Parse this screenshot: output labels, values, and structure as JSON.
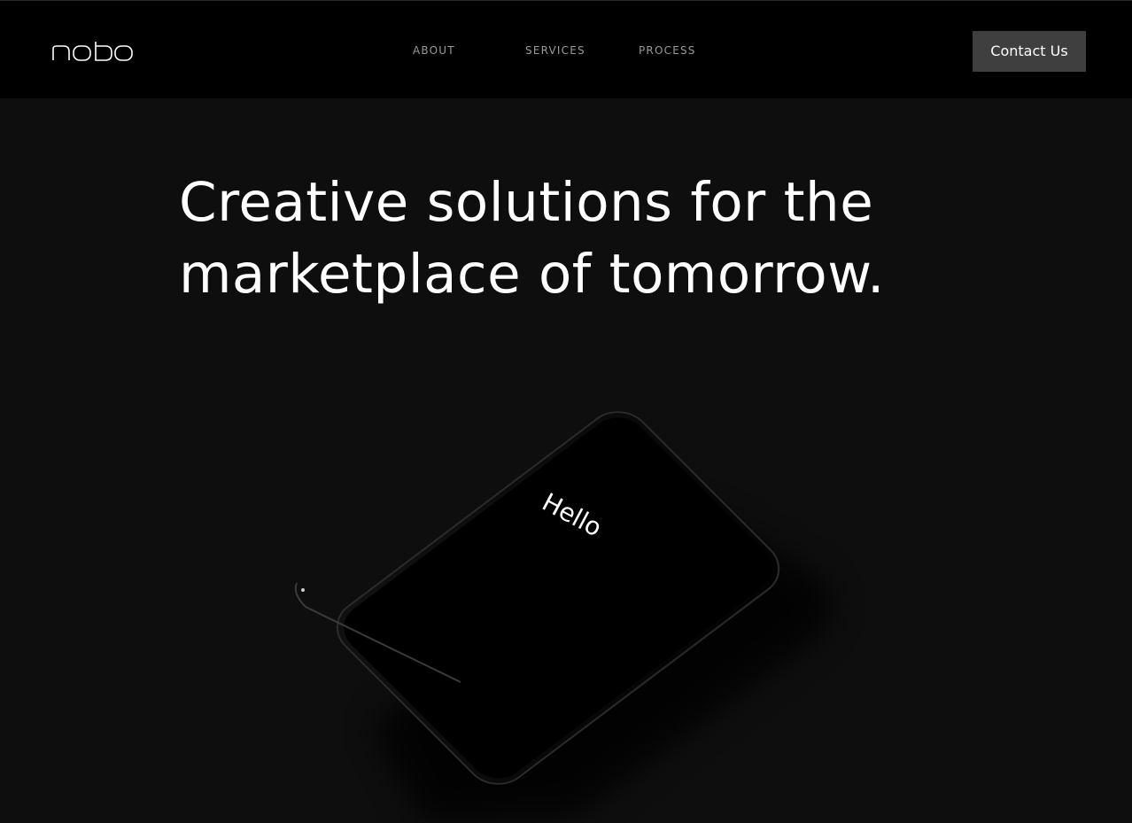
{
  "brand": {
    "logo_text": "nobo"
  },
  "nav": {
    "items": [
      {
        "label": "ABOUT"
      },
      {
        "label": "SERVICES"
      },
      {
        "label": "PROCESS"
      }
    ],
    "contact_label": "Contact Us"
  },
  "hero": {
    "title_line1": "Creative solutions for the",
    "title_line2": "marketplace of tomorrow.",
    "phone_screen_text": "Hello"
  },
  "colors": {
    "header_bg": "#000000",
    "page_bg": "#0e0e0e",
    "button_bg": "#3f3f3f",
    "nav_text": "#9a9a9a",
    "title_text": "#ffffff"
  }
}
